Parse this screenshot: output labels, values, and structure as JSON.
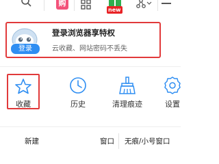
{
  "toolbar": {
    "app_icon_glyph": "购",
    "new_badge": "new",
    "icons": [
      "search-icon",
      "app-icon",
      "grid-icon",
      "gift-icon",
      "share-icon",
      "minimize-icon"
    ]
  },
  "login_card": {
    "badge_label": "登录",
    "title": "登录浏览器享特权",
    "subtitle": "云收藏、网站密码不丢失",
    "highlight_color": "#e1393a",
    "badge_color": "#2f8ef2"
  },
  "quick_actions": [
    {
      "label": "收藏",
      "icon": "star-icon"
    },
    {
      "label": "历史",
      "icon": "clock-icon"
    },
    {
      "label": "清理痕迹",
      "icon": "broom-icon"
    },
    {
      "label": "设置",
      "icon": "gear-icon"
    }
  ],
  "menu_row": {
    "new_label": "新建",
    "window_label": "窗口",
    "mode_label": "无痕/小号窗口"
  },
  "colors": {
    "accent_blue": "#2f8ef2",
    "highlight_red": "#e1393a"
  }
}
